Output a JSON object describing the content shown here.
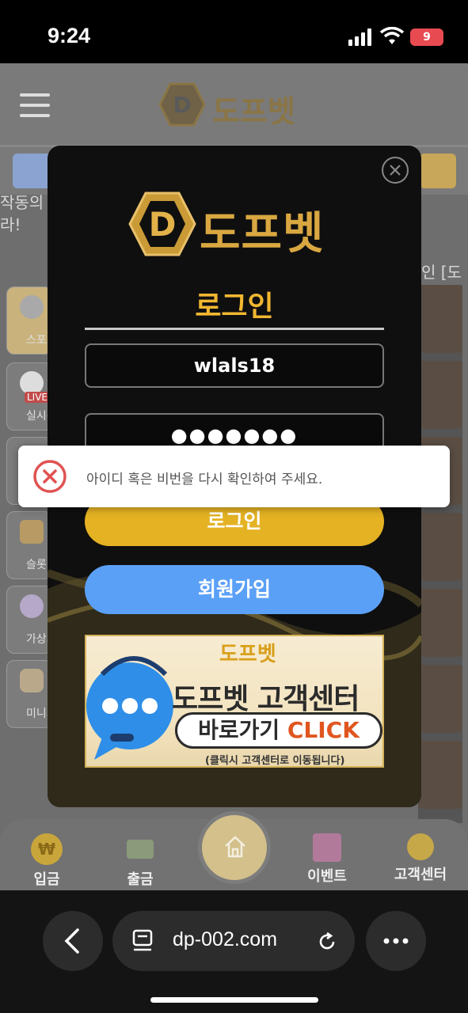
{
  "status_bar": {
    "time": "9:24",
    "battery": "9"
  },
  "site": {
    "brand": "도프벳",
    "marquee_left": "작동의\n라!",
    "marquee_right": "인 [도",
    "side_menu": [
      "스포츠",
      "실시간",
      "",
      "슬롯",
      "가상게임",
      "미니게임"
    ],
    "live_badge": "LIVE",
    "bottom_nav": [
      {
        "label": "입금",
        "icon": "won-coin-icon"
      },
      {
        "label": "출금",
        "icon": "cash-icon"
      },
      {
        "label": "이벤트",
        "icon": "gift-icon"
      },
      {
        "label": "고객센터",
        "icon": "chat-bubble-icon"
      }
    ]
  },
  "modal": {
    "brand": "도프벳",
    "title": "로그인",
    "username_value": "wlals18",
    "password_value": "●●●●●●●",
    "login_button": "로그인",
    "signup_button": "회원가입",
    "banner": {
      "brand": "도프벳",
      "title": "도프벳 고객센터",
      "cta_korean": "바로가기",
      "cta_click": "CLICK",
      "note": "(클릭시 고객센터로 이동됩니다)"
    }
  },
  "toast": {
    "message": "아이디 혹은 비번을 다시 확인하여 주세요."
  },
  "browser": {
    "url": "dp-002.com"
  },
  "colors": {
    "gold": "#e4b223",
    "blue": "#5ba0f7",
    "error_red": "#e05252"
  }
}
